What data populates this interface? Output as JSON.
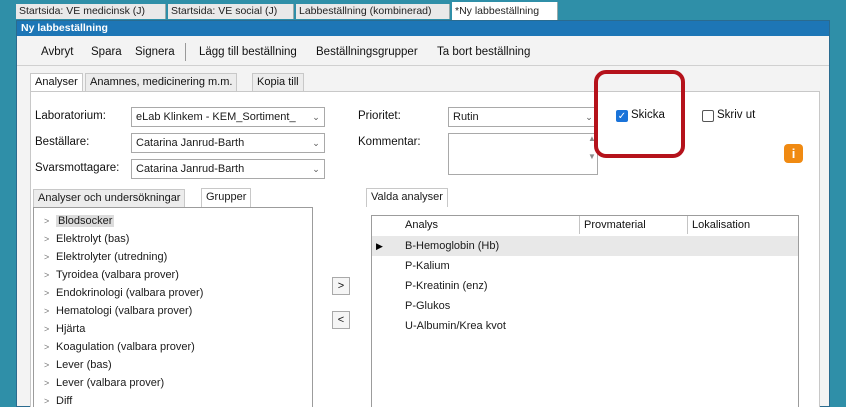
{
  "doc_tabs": [
    "Startsida: VE medicinsk (J)",
    "Startsida: VE social (J)",
    "Labbeställning (kombinerad)",
    "*Ny labbeställning"
  ],
  "window": {
    "title": "Ny labbeställning"
  },
  "toolbar": {
    "cancel": "Avbryt",
    "save": "Spara",
    "sign": "Signera",
    "add_order": "Lägg till beställning",
    "order_groups": "Beställningsgrupper",
    "remove_order": "Ta bort beställning"
  },
  "tabs": [
    "Analyser",
    "Anamnes, medicinering m.m.",
    "Kopia till"
  ],
  "form": {
    "lab_label": "Laboratorium:",
    "lab_value": "eLab Klinkem - KEM_Sortiment_",
    "orderer_label": "Beställare:",
    "orderer_value": "Catarina Janrud-Barth",
    "recipient_label": "Svarsmottagare:",
    "recipient_value": "Catarina Janrud-Barth",
    "priority_label": "Prioritet:",
    "priority_value": "Rutin",
    "comment_label": "Kommentar:",
    "send_label": "Skicka",
    "send_checked": true,
    "print_label": "Skriv ut",
    "print_checked": false
  },
  "left_tabs": [
    "Analyser och undersökningar",
    "Grupper"
  ],
  "groups": [
    "Blodsocker",
    "Elektrolyt (bas)",
    "Elektrolyter (utredning)",
    "Tyroidea (valbara prover)",
    "Endokrinologi (valbara prover)",
    "Hematologi (valbara prover)",
    "Hjärta",
    "Koagulation (valbara prover)",
    "Lever (bas)",
    "Lever (valbara prover)",
    "Diff"
  ],
  "move": {
    "add": ">",
    "remove": "<"
  },
  "right_tab": "Valda analyser",
  "grid": {
    "columns": [
      "Analys",
      "Provmaterial",
      "Lokalisation"
    ],
    "rows": [
      "B-Hemoglobin (Hb)",
      "P-Kalium",
      "P-Kreatinin (enz)",
      "P-Glukos",
      "U-Albumin/Krea kvot"
    ]
  },
  "colors": {
    "accent": "#1d76b6",
    "highlight": "#b5121b",
    "info": "#f08a12"
  }
}
